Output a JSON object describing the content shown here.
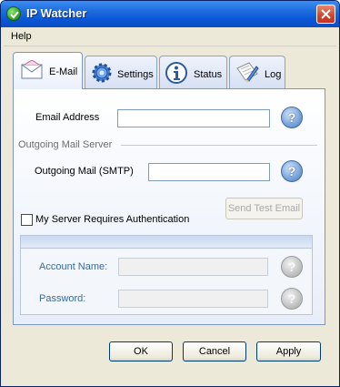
{
  "window": {
    "title": "IP Watcher",
    "close_icon": "close-icon"
  },
  "menu": {
    "help": "Help"
  },
  "tabs": [
    {
      "label": "E-Mail",
      "icon": "envelope-icon",
      "active": true
    },
    {
      "label": "Settings",
      "icon": "gear-icon",
      "active": false
    },
    {
      "label": "Status",
      "icon": "info-icon",
      "active": false
    },
    {
      "label": "Log",
      "icon": "log-icon",
      "active": false
    }
  ],
  "email": {
    "email_address_label": "Email Address",
    "email_address_value": "",
    "outgoing_section_label": "Outgoing Mail Server",
    "smtp_label": "Outgoing Mail (SMTP)",
    "smtp_value": "",
    "send_test_label": "Send Test Email",
    "auth_checkbox_label": "My Server Requires Authentication",
    "auth_checked": false,
    "account_name_label": "Account Name:",
    "account_name_value": "",
    "password_label": "Password:",
    "password_value": "",
    "help_glyph": "?"
  },
  "buttons": {
    "ok": "OK",
    "cancel": "Cancel",
    "apply": "Apply"
  },
  "colors": {
    "titlebar": "#0b56d6",
    "accent": "#7d96c6"
  }
}
